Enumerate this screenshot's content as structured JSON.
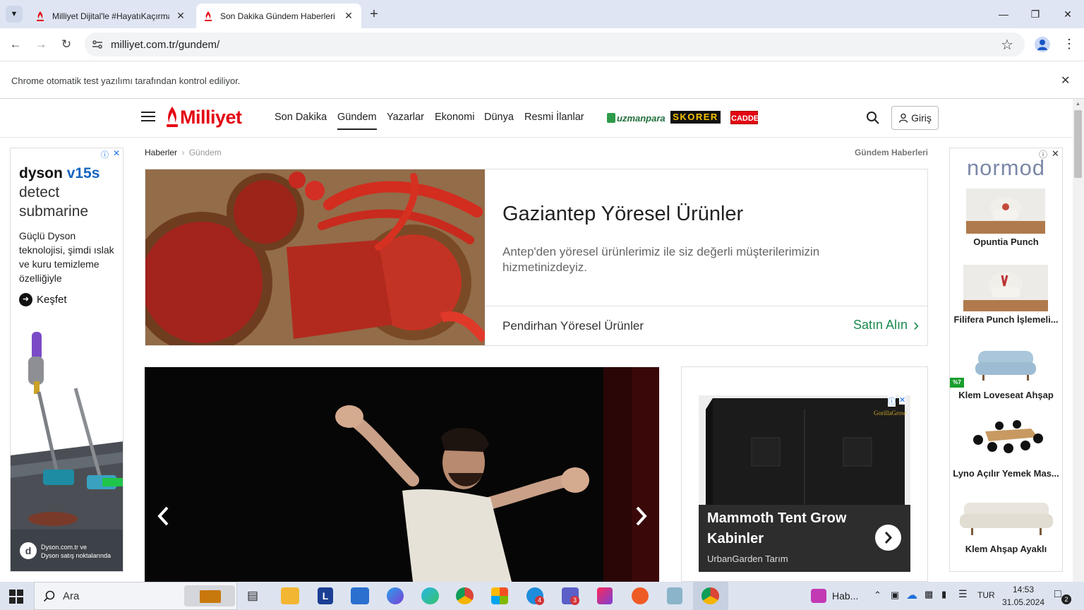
{
  "browser": {
    "tabs": [
      {
        "title": "Milliyet Dijital'le #HayatıKaçırma",
        "active": false
      },
      {
        "title": "Son Dakika Gündem Haberleri - Milliyet",
        "active": true
      }
    ],
    "url": "milliyet.com.tr/gundem/",
    "infobar_text": "Chrome otomatik test yazılımı tarafından kontrol ediliyor."
  },
  "site": {
    "logo": "Milliyet",
    "nav": [
      "Son Dakika",
      "Gündem",
      "Yazarlar",
      "Ekonomi",
      "Dünya",
      "Resmi İlanlar"
    ],
    "active_nav": "Gündem",
    "partners": [
      "uzmanpara",
      "SKORER",
      "CADDE"
    ],
    "login_label": "Giriş",
    "breadcrumb": [
      "Haberler",
      "Gündem"
    ],
    "section_label": "Gündem Haberleri"
  },
  "left_ad": {
    "brand": "dyson",
    "model": "v15s",
    "line2": "detect",
    "line3": "submarine",
    "description": "Güçlü Dyson teknolojisi, şimdi ıslak ve kuru temizleme özelliğiyle",
    "cta": "Keşfet",
    "footer_line1": "Dyson.com.tr ve",
    "footer_line2": "Dyson satış noktalarında"
  },
  "banner_ad": {
    "title": "Gaziantep Yöresel Ürünler",
    "description": "Antep'den yöresel ürünlerimiz ile siz değerli müşterilerimizin hizmetinizdeyiz.",
    "advertiser": "Pendirhan Yöresel Ürünler",
    "cta": "Satın Alın"
  },
  "side_ad": {
    "title": "Mammoth Tent Grow Kabinler",
    "advertiser": "UrbanGarden Tarım",
    "brand_on_image": "GorillaGrow"
  },
  "right_ad": {
    "brand": "normod",
    "discount_badge": "%7",
    "products": [
      "Opuntia Punch",
      "Filifera Punch İşlemeli...",
      "Klem Loveseat Ahşap",
      "Lyno Açılır Yemek Mas...",
      "Klem Ahşap Ayaklı"
    ]
  },
  "taskbar": {
    "search_placeholder": "Ara",
    "active_app_label": "Hab...",
    "language": "TUR",
    "time": "14:53",
    "date": "31.05.2024",
    "notification_count": "2",
    "skype_badge": "4",
    "teams_badge": "3",
    "app_l_label": "L"
  },
  "colors": {
    "milliyet_red": "#e30613",
    "tabstrip_bg": "#dfe5f3",
    "cta_green": "#1a8a4e",
    "dyson_blue": "#1565c0"
  }
}
